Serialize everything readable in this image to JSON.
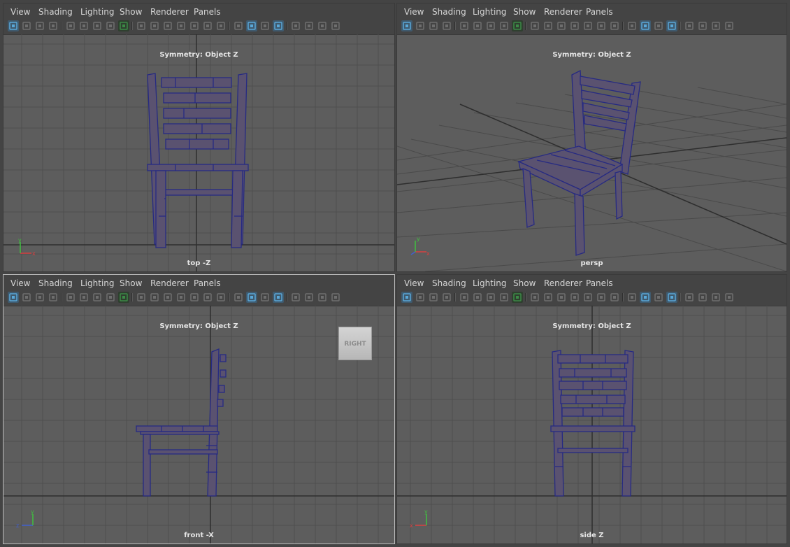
{
  "menu": [
    "View",
    "Shading",
    "Lighting",
    "Show",
    "Renderer",
    "Panels"
  ],
  "symmetry_label": "Symmetry: Object Z",
  "viewports": [
    {
      "camera": "top -Z",
      "axis_h": "x",
      "axis_v": "y"
    },
    {
      "camera": "persp",
      "axis_h": "x",
      "axis_v": "y"
    },
    {
      "camera": "front -X",
      "axis_h": "z",
      "axis_v": "y",
      "viewcube": "RIGHT"
    },
    {
      "camera": "side Z",
      "axis_h": "x",
      "axis_v": "y"
    }
  ],
  "toolbar_icons": [
    "select-camera-icon",
    "lock-camera-icon",
    "bookmarks-icon",
    "film-gate-icon",
    "camera-icon",
    "camera-attributes-icon",
    "image-plane-icon",
    "two-d-pan-icon",
    "grease-pencil-icon",
    "grid-icon",
    "film-gate-toggle-icon",
    "resolution-gate-icon",
    "gate-mask-icon",
    "field-chart-icon",
    "safe-action-icon",
    "safe-title-icon",
    "wireframe-icon",
    "smooth-shade-icon",
    "default-material-icon",
    "wireframe-on-shaded-icon",
    "xray-icon",
    "use-all-lights-icon",
    "shadows-icon",
    "isolate-select-icon"
  ],
  "colors": {
    "panel_bg": "#5d5d5d",
    "grid": "#4e4e4e",
    "chair_stroke": "#2a2a7a",
    "chair_fill": "#58506c",
    "accent": "#5aa8d8"
  }
}
